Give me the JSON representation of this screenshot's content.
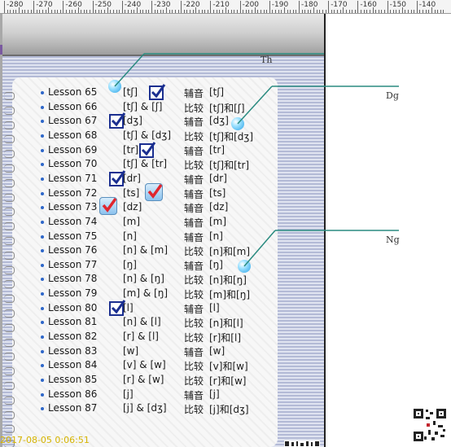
{
  "ruler": {
    "labels": [
      "-280",
      "-270",
      "-260",
      "-250",
      "-240",
      "-230",
      "-220",
      "-210",
      "-200",
      "-190",
      "-180",
      "-170",
      "-160",
      "-150",
      "-140"
    ]
  },
  "callouts": {
    "th": "Th",
    "dg": "Dg",
    "ng": "Ng"
  },
  "lessons": [
    {
      "lesson": "Lesson 65",
      "sym": "[tʃ]",
      "kind": "辅音",
      "sym2": "[tʃ]"
    },
    {
      "lesson": "Lesson 66",
      "sym": "[tʃ] & [ʃ]",
      "kind": "比较",
      "sym2": "[tʃ]和[ʃ]"
    },
    {
      "lesson": "Lesson 67",
      "sym": "[dʒ]",
      "kind": "辅音",
      "sym2": "[dʒ]"
    },
    {
      "lesson": "Lesson 68",
      "sym": "[tʃ] & [dʒ]",
      "kind": "比较",
      "sym2": "[tʃ]和[dʒ]"
    },
    {
      "lesson": "Lesson 69",
      "sym": "[tr]",
      "kind": "辅音",
      "sym2": "[tr]"
    },
    {
      "lesson": "Lesson 70",
      "sym": "[tʃ] & [tr]",
      "kind": "比较",
      "sym2": "[tʃ]和[tr]"
    },
    {
      "lesson": "Lesson 71",
      "sym": "[dr]",
      "kind": "辅音",
      "sym2": "[dr]"
    },
    {
      "lesson": "Lesson 72",
      "sym": "[ts]",
      "kind": "辅音",
      "sym2": "[ts]"
    },
    {
      "lesson": "Lesson 73",
      "sym": "[dz]",
      "kind": "辅音",
      "sym2": "[dz]"
    },
    {
      "lesson": "Lesson 74",
      "sym": "[m]",
      "kind": "辅音",
      "sym2": "[m]"
    },
    {
      "lesson": "Lesson 75",
      "sym": "[n]",
      "kind": "辅音",
      "sym2": "[n]"
    },
    {
      "lesson": "Lesson 76",
      "sym": "[n] & [m]",
      "kind": "比较",
      "sym2": "[n]和[m]"
    },
    {
      "lesson": "Lesson 77",
      "sym": "[ŋ]",
      "kind": "辅音",
      "sym2": "[ŋ]"
    },
    {
      "lesson": "Lesson 78",
      "sym": "[n] & [ŋ]",
      "kind": "比较",
      "sym2": "[n]和[ŋ]"
    },
    {
      "lesson": "Lesson 79",
      "sym": "[m] & [ŋ]",
      "kind": "比较",
      "sym2": "[m]和[ŋ]"
    },
    {
      "lesson": "Lesson 80",
      "sym": "[l]",
      "kind": "辅音",
      "sym2": "[l]"
    },
    {
      "lesson": "Lesson 81",
      "sym": "[n] & [l]",
      "kind": "比较",
      "sym2": "[n]和[l]"
    },
    {
      "lesson": "Lesson 82",
      "sym": "[r] & [l]",
      "kind": "比较",
      "sym2": "[r]和[l]"
    },
    {
      "lesson": "Lesson 83",
      "sym": "[w]",
      "kind": "辅音",
      "sym2": "[w]"
    },
    {
      "lesson": "Lesson 84",
      "sym": "[v] & [w]",
      "kind": "比较",
      "sym2": "[v]和[w]"
    },
    {
      "lesson": "Lesson 85",
      "sym": "[r] & [w]",
      "kind": "比较",
      "sym2": "[r]和[w]"
    },
    {
      "lesson": "Lesson 86",
      "sym": "[j]",
      "kind": "辅音",
      "sym2": "[j]"
    },
    {
      "lesson": "Lesson 87",
      "sym": "[j] & [dʒ]",
      "kind": "比较",
      "sym2": "[j]和[dʒ]"
    }
  ],
  "checks": [
    {
      "style": "box",
      "lesson": "Lesson 65"
    },
    {
      "style": "box",
      "lesson": "Lesson 67"
    },
    {
      "style": "box",
      "lesson": "Lesson 69"
    },
    {
      "style": "box",
      "lesson": "Lesson 71"
    },
    {
      "style": "red",
      "lesson": "Lesson 72"
    },
    {
      "style": "red",
      "lesson": "Lesson 73"
    },
    {
      "style": "box",
      "lesson": "Lesson 80"
    }
  ],
  "timestamp": "2017-08-05 0:06:51",
  "colors": {
    "bullet": "#2e67c9",
    "check_box": "#1b2f90",
    "check_red": "#e0262e",
    "callout_line": "#2a8b80",
    "timestamp": "#d6b400"
  }
}
